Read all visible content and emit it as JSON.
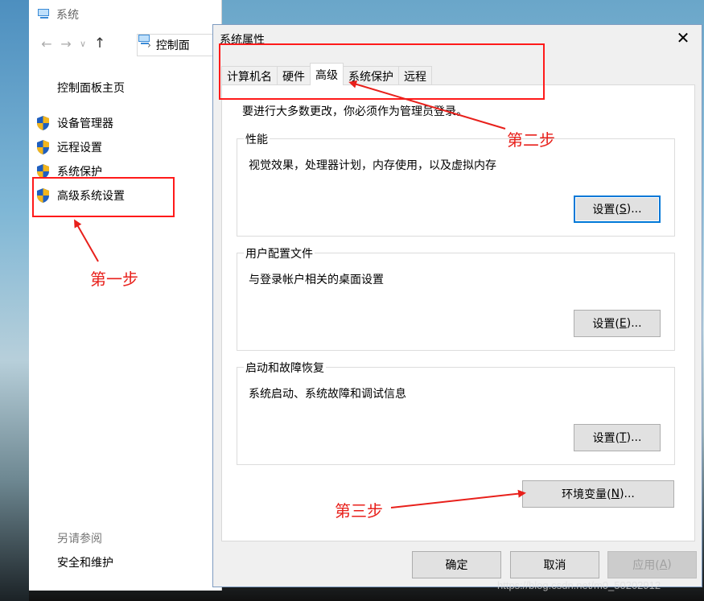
{
  "system_window": {
    "title": "系统",
    "address_text": "控制面",
    "home_link": "控制面板主页",
    "links": [
      "设备管理器",
      "远程设置",
      "系统保护",
      "高级系统设置"
    ],
    "see_also": "另请参阅",
    "security_link": "安全和维护"
  },
  "dialog": {
    "title": "系统属性",
    "close_glyph": "✕",
    "tabs": [
      "计算机名",
      "硬件",
      "高级",
      "系统保护",
      "远程"
    ],
    "active_tab": "高级",
    "admin_note": "要进行大多数更改，你必须作为管理员登录。",
    "groups": [
      {
        "label": "性能",
        "desc": "视觉效果，处理器计划，内存使用，以及虚拟内存",
        "button": "设置(",
        "key": "S",
        "suffix": ")..."
      },
      {
        "label": "用户配置文件",
        "desc": "与登录帐户相关的桌面设置",
        "button": "设置(",
        "key": "E",
        "suffix": ")..."
      },
      {
        "label": "启动和故障恢复",
        "desc": "系统启动、系统故障和调试信息",
        "button": "设置(",
        "key": "T",
        "suffix": ")..."
      }
    ],
    "env_button": {
      "text": "环境变量(",
      "key": "N",
      "suffix": ")..."
    },
    "ok_button": "确定",
    "cancel_button": "取消",
    "apply_button": {
      "text": "应用(",
      "key": "A",
      "suffix": ")"
    }
  },
  "annotations": {
    "step1": "第一步",
    "step2": "第二步",
    "step3": "第三步",
    "color": "#e8201b"
  },
  "watermark": "https://blog.csdn.net/m0_50202912"
}
